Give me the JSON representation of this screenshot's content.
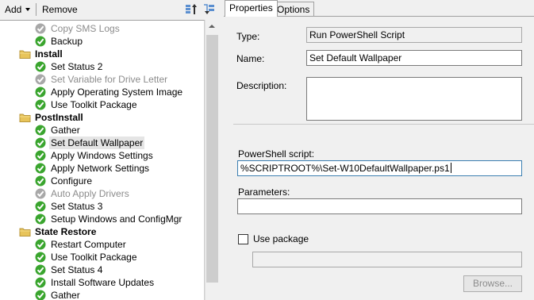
{
  "toolbar": {
    "add_label": "Add",
    "remove_label": "Remove",
    "move_up_icon": "move-up-icon",
    "move_down_icon": "move-down-icon"
  },
  "tree": {
    "items": [
      {
        "label": "Copy SMS Logs",
        "icon": "disabled-step-icon",
        "kind": "step",
        "state": "disabled"
      },
      {
        "label": "Backup",
        "icon": "check-icon",
        "kind": "step",
        "state": "enabled"
      },
      {
        "label": "Install",
        "icon": "folder-icon",
        "kind": "group",
        "state": "enabled"
      },
      {
        "label": "Set Status 2",
        "icon": "check-icon",
        "kind": "step",
        "state": "enabled"
      },
      {
        "label": "Set Variable for Drive Letter",
        "icon": "disabled-step-icon",
        "kind": "step",
        "state": "disabled"
      },
      {
        "label": "Apply Operating System Image",
        "icon": "check-icon",
        "kind": "step",
        "state": "enabled"
      },
      {
        "label": "Use Toolkit Package",
        "icon": "check-icon",
        "kind": "step",
        "state": "enabled"
      },
      {
        "label": "PostInstall",
        "icon": "folder-icon",
        "kind": "group",
        "state": "enabled"
      },
      {
        "label": "Gather",
        "icon": "check-icon",
        "kind": "step",
        "state": "enabled"
      },
      {
        "label": "Set Default Wallpaper",
        "icon": "check-icon",
        "kind": "step",
        "state": "selected"
      },
      {
        "label": "Apply Windows Settings",
        "icon": "check-icon",
        "kind": "step",
        "state": "enabled"
      },
      {
        "label": "Apply Network Settings",
        "icon": "check-icon",
        "kind": "step",
        "state": "enabled"
      },
      {
        "label": "Configure",
        "icon": "check-icon",
        "kind": "step",
        "state": "enabled"
      },
      {
        "label": "Auto Apply Drivers",
        "icon": "disabled-step-icon",
        "kind": "step",
        "state": "disabled"
      },
      {
        "label": "Set Status 3",
        "icon": "check-icon",
        "kind": "step",
        "state": "enabled"
      },
      {
        "label": "Setup Windows and ConfigMgr",
        "icon": "check-icon",
        "kind": "step",
        "state": "enabled"
      },
      {
        "label": "State Restore",
        "icon": "folder-icon",
        "kind": "group",
        "state": "enabled"
      },
      {
        "label": "Restart Computer",
        "icon": "check-icon",
        "kind": "step",
        "state": "enabled"
      },
      {
        "label": "Use Toolkit Package",
        "icon": "check-icon",
        "kind": "step",
        "state": "enabled"
      },
      {
        "label": "Set Status 4",
        "icon": "check-icon",
        "kind": "step",
        "state": "enabled"
      },
      {
        "label": "Install Software Updates",
        "icon": "check-icon",
        "kind": "step",
        "state": "enabled"
      },
      {
        "label": "Gather",
        "icon": "check-icon",
        "kind": "step",
        "state": "enabled"
      }
    ]
  },
  "tabs": {
    "properties": "Properties",
    "options": "Options",
    "active": "Properties"
  },
  "properties": {
    "type_label": "Type:",
    "type_value": "Run PowerShell Script",
    "name_label": "Name:",
    "name_value": "Set Default Wallpaper",
    "description_label": "Description:",
    "description_value": "",
    "script_label": "PowerShell script:",
    "script_value": "%SCRIPTROOT%\\Set-W10DefaultWallpaper.ps1",
    "parameters_label": "Parameters:",
    "parameters_value": "",
    "use_package_label": "Use package",
    "use_package_checked": false,
    "package_value": "",
    "browse_label": "Browse..."
  },
  "colors": {
    "check_green": "#3aa52e",
    "folder_yellow": "#e8c45a",
    "disabled_gray": "#a8a8a8",
    "selection": "#e5e5e5"
  }
}
